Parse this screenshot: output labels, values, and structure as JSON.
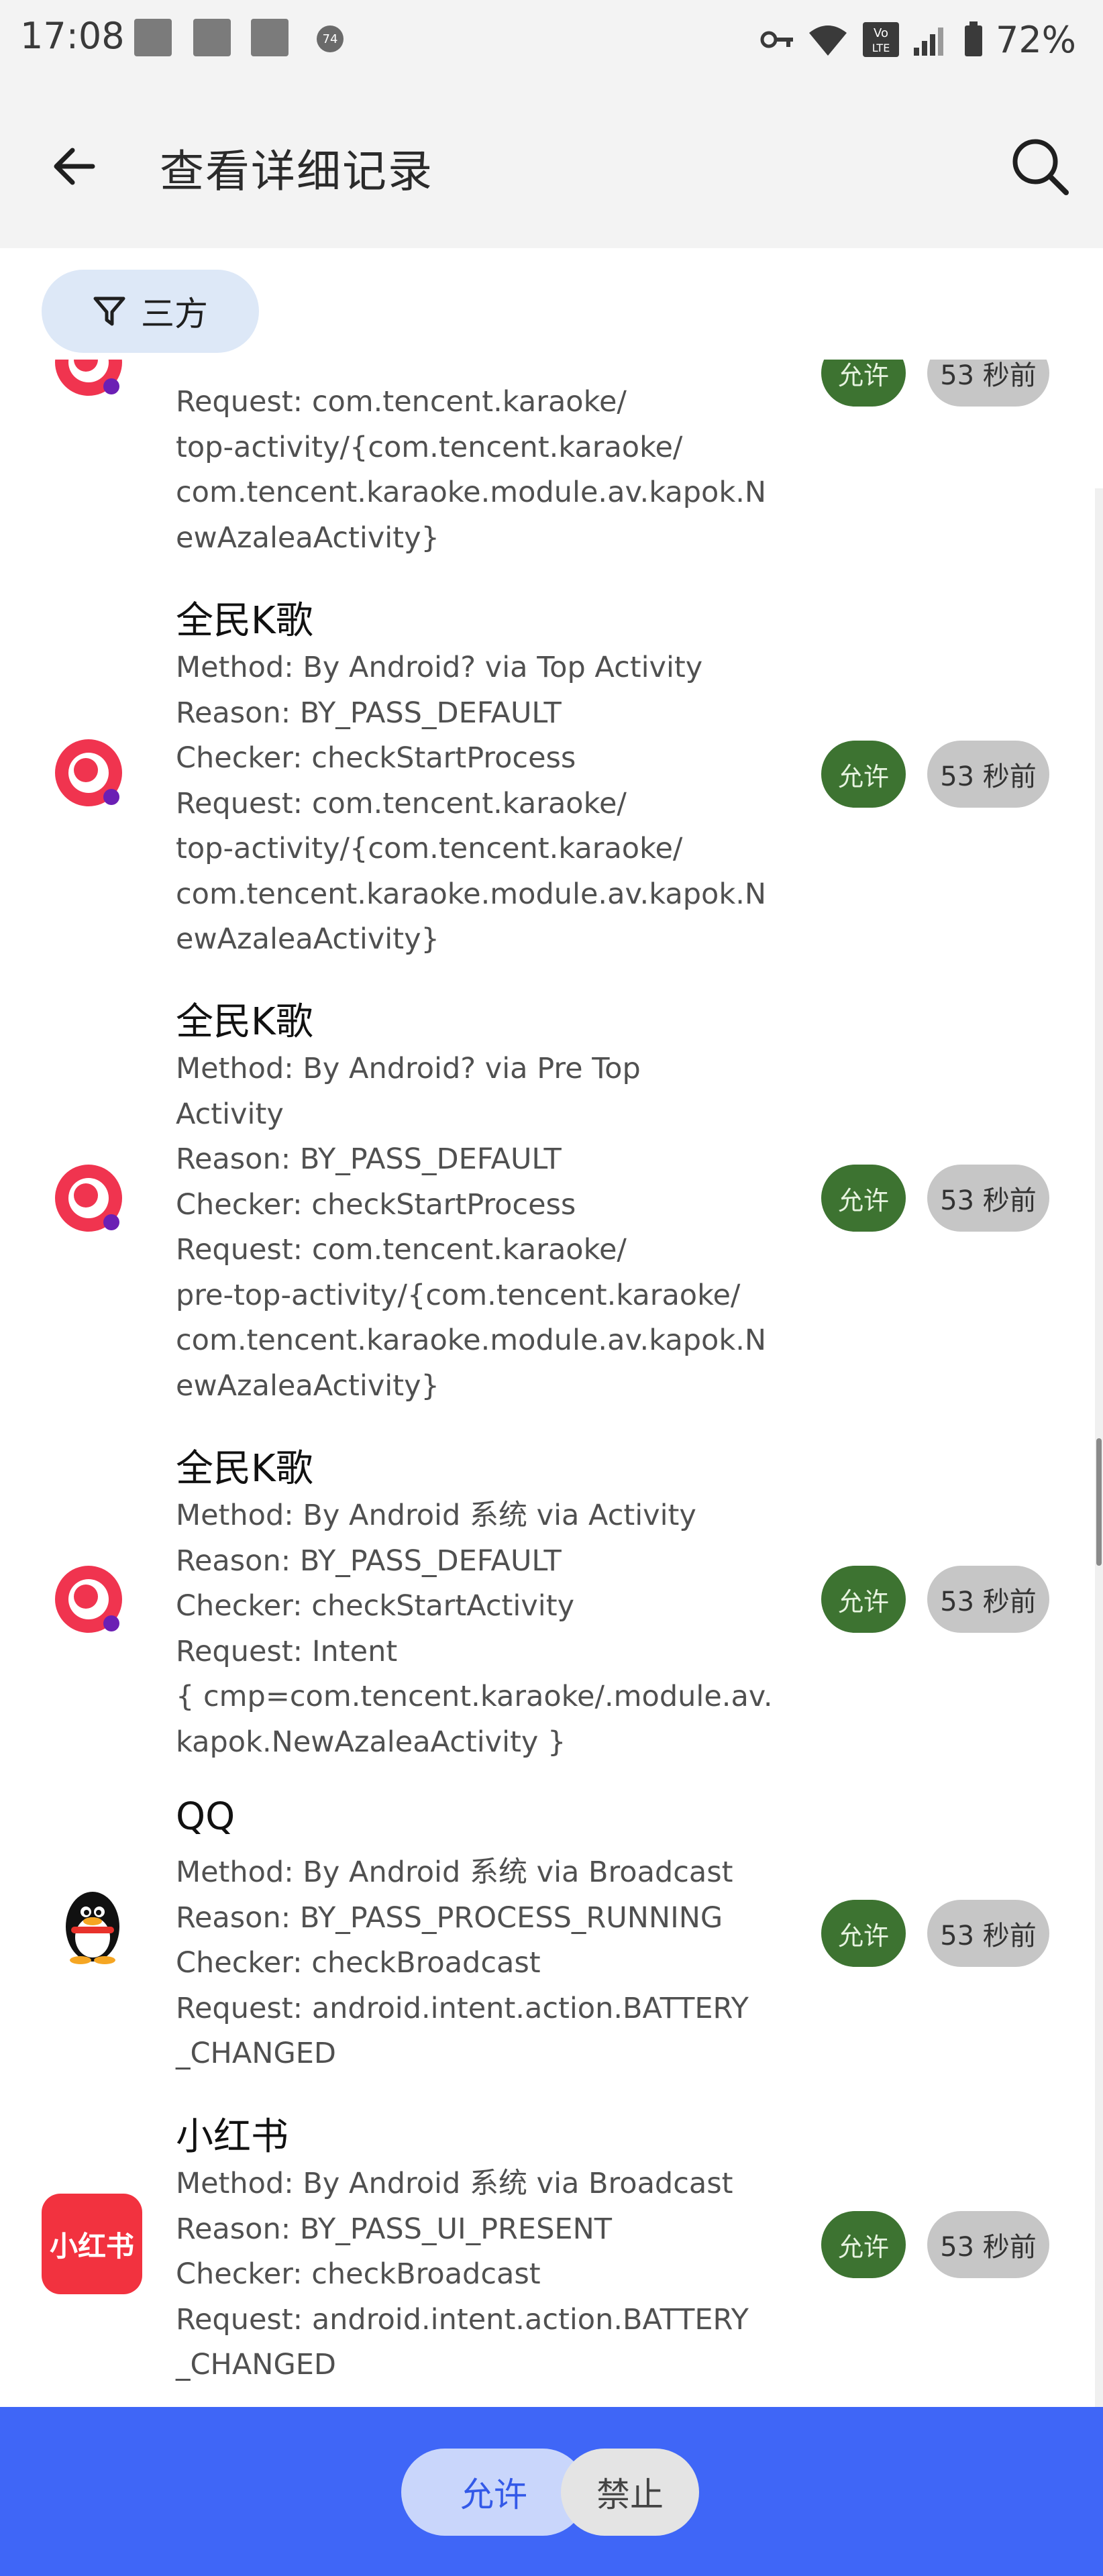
{
  "status_bar": {
    "time": "17:08",
    "notif_badge": "74",
    "battery": "72%",
    "icons": [
      "key-icon",
      "wifi-icon",
      "volte-icon",
      "signal-icon",
      "battery-icon"
    ]
  },
  "header": {
    "title": "查看详细记录",
    "back_icon": "arrow-left-icon",
    "search_icon": "search-icon"
  },
  "filter": {
    "label": "三方",
    "icon": "filter-icon"
  },
  "records": [
    {
      "app": "",
      "icon": "karaoke-icon",
      "lines": "Request: com.tencent.karaoke/\ntop-activity/{com.tencent.karaoke/\ncom.tencent.karaoke.module.av.kapok.N\newAzaleaActivity}",
      "status": "允许",
      "time": "53 秒前"
    },
    {
      "app": "全民K歌",
      "icon": "karaoke-icon",
      "lines": "Method: By Android? via Top Activity\nReason: BY_PASS_DEFAULT\nChecker: checkStartProcess\nRequest: com.tencent.karaoke/\ntop-activity/{com.tencent.karaoke/\ncom.tencent.karaoke.module.av.kapok.N\newAzaleaActivity}",
      "status": "允许",
      "time": "53 秒前"
    },
    {
      "app": "全民K歌",
      "icon": "karaoke-icon",
      "lines": "Method: By Android? via Pre Top\nActivity\nReason: BY_PASS_DEFAULT\nChecker: checkStartProcess\nRequest: com.tencent.karaoke/\npre-top-activity/{com.tencent.karaoke/\ncom.tencent.karaoke.module.av.kapok.N\newAzaleaActivity}",
      "status": "允许",
      "time": "53 秒前"
    },
    {
      "app": "全民K歌",
      "icon": "karaoke-icon",
      "lines": "Method: By Android 系统 via Activity\nReason: BY_PASS_DEFAULT\nChecker: checkStartActivity\nRequest: Intent\n{ cmp=com.tencent.karaoke/.module.av.\nkapok.NewAzaleaActivity }",
      "status": "允许",
      "time": "53 秒前"
    },
    {
      "app": "QQ",
      "icon": "qq-penguin-icon",
      "lines": "Method: By Android 系统 via Broadcast\nReason: BY_PASS_PROCESS_RUNNING\nChecker: checkBroadcast\nRequest: android.intent.action.BATTERY\n_CHANGED",
      "status": "允许",
      "time": "53 秒前"
    },
    {
      "app": "小红书",
      "icon": "xiaohongshu-icon",
      "icon_text": "小红书",
      "lines": "Method: By Android 系统 via Broadcast\nReason: BY_PASS_UI_PRESENT\nChecker: checkBroadcast\nRequest: android.intent.action.BATTERY\n_CHANGED",
      "status": "允许",
      "time": "53 秒前"
    }
  ],
  "bottom_bar": {
    "allow": "允许",
    "deny": "禁止"
  },
  "colors": {
    "accent": "#3f66f7",
    "allow_badge": "#3d7331",
    "chip": "#dde8f7"
  }
}
